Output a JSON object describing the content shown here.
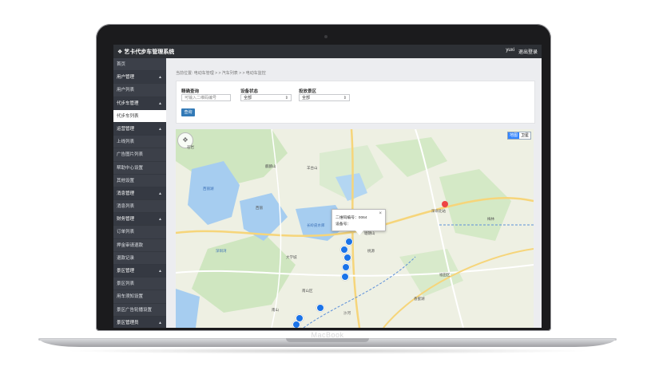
{
  "device": {
    "label": "MacBook"
  },
  "header": {
    "title": "艺卡代步车管理系统",
    "user": "yuxi",
    "logout": "退出登录"
  },
  "sidebar": {
    "items": [
      {
        "label": "首页",
        "type": "item",
        "active": false
      },
      {
        "label": "用户管理",
        "type": "group",
        "active": false
      },
      {
        "label": "用户列表",
        "type": "item",
        "active": false
      },
      {
        "label": "代步车管理",
        "type": "group",
        "active": false
      },
      {
        "label": "代步车列表",
        "type": "item",
        "active": true
      },
      {
        "label": "运营管理",
        "type": "group",
        "active": false
      },
      {
        "label": "上线列表",
        "type": "item",
        "active": false
      },
      {
        "label": "广告图片列表",
        "type": "item",
        "active": false
      },
      {
        "label": "帮助中心设置",
        "type": "item",
        "active": false
      },
      {
        "label": "其他设置",
        "type": "item",
        "active": false
      },
      {
        "label": "消息管理",
        "type": "group",
        "active": false
      },
      {
        "label": "消息列表",
        "type": "item",
        "active": false
      },
      {
        "label": "财务管理",
        "type": "group",
        "active": false
      },
      {
        "label": "订单列表",
        "type": "item",
        "active": false
      },
      {
        "label": "押金审请退款",
        "type": "item",
        "active": false
      },
      {
        "label": "退款记录",
        "type": "item",
        "active": false
      },
      {
        "label": "景区管理",
        "type": "group",
        "active": false
      },
      {
        "label": "景区列表",
        "type": "item",
        "active": false
      },
      {
        "label": "用车须知设置",
        "type": "item",
        "active": false
      },
      {
        "label": "景区广告轮播设置",
        "type": "item",
        "active": false
      },
      {
        "label": "景区管理员",
        "type": "group",
        "active": false
      }
    ]
  },
  "breadcrumb": "当前位置: 电动车管理 > > 汽车列表 > > 电动车监控",
  "filters": {
    "search": {
      "label": "精确查询",
      "placeholder": "可输入二维码编号"
    },
    "status": {
      "label": "设备状态",
      "value": "全部"
    },
    "area": {
      "label": "投放景区",
      "value": "全部"
    },
    "query_button": "查询"
  },
  "map": {
    "type_toggle": [
      "地图",
      "卫星"
    ],
    "active_type": "地图",
    "popup": {
      "qr_line": "二维码编号：0064",
      "device_line": "设备号："
    },
    "labels": [
      "西丽湖",
      "石岩",
      "麒麟山",
      "羊台山",
      "长岭皮水库",
      "深圳湾",
      "南山区",
      "福田区",
      "塘朗山",
      "大学城",
      "桃源",
      "西丽",
      "梅林",
      "深圳北站",
      "香蜜湖",
      "南山",
      "沙河"
    ]
  }
}
